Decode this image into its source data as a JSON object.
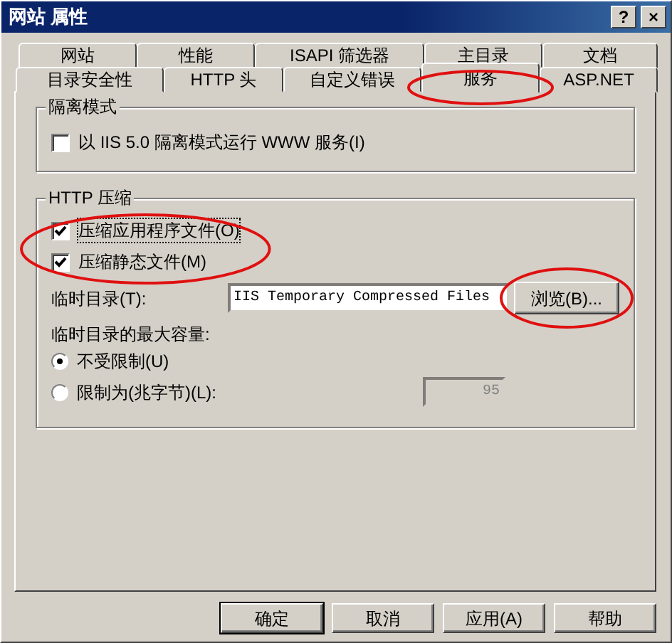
{
  "window": {
    "title": "网站 属性",
    "controls": [
      "?",
      "×"
    ]
  },
  "tab_rows": [
    [
      {
        "label": "网站",
        "selected": false,
        "circled": false
      },
      {
        "label": "性能",
        "selected": false,
        "circled": false
      },
      {
        "label": "ISAPI 筛选器",
        "selected": false,
        "circled": false
      },
      {
        "label": "主目录",
        "selected": false,
        "circled": false
      },
      {
        "label": "文档",
        "selected": false,
        "circled": false
      }
    ],
    [
      {
        "label": "目录安全性",
        "selected": false,
        "circled": false
      },
      {
        "label": "HTTP 头",
        "selected": false,
        "circled": false
      },
      {
        "label": "自定义错误",
        "selected": false,
        "circled": false
      },
      {
        "label": "服务",
        "selected": true,
        "circled": true
      },
      {
        "label": "ASP.NET",
        "selected": false,
        "circled": false
      }
    ]
  ],
  "isolation": {
    "title": "隔离模式",
    "checkbox": {
      "label": "以 IIS 5.0 隔离模式运行 WWW 服务(I)",
      "checked": false
    }
  },
  "compression": {
    "title": "HTTP 压缩",
    "options_circled": true,
    "options": [
      {
        "label": "压缩应用程序文件(O)",
        "checked": true,
        "focused": true
      },
      {
        "label": "压缩静态文件(M)",
        "checked": true,
        "focused": false
      }
    ],
    "temp_dir": {
      "label": "临时目录(T):",
      "value": "IIS Temporary Compressed Files",
      "browse": {
        "label": "浏览(B)...",
        "circled": true
      }
    },
    "max_size_label": "临时目录的最大容量:",
    "radios": [
      {
        "label": "不受限制(U)",
        "selected": true
      },
      {
        "label": "限制为(兆字节)(L):",
        "selected": false
      }
    ],
    "limit": {
      "value": "95",
      "disabled": true
    }
  },
  "buttons": [
    {
      "label": "确定",
      "default": true
    },
    {
      "label": "取消",
      "default": false
    },
    {
      "label": "应用(A)",
      "default": false
    },
    {
      "label": "帮助",
      "default": false
    }
  ]
}
